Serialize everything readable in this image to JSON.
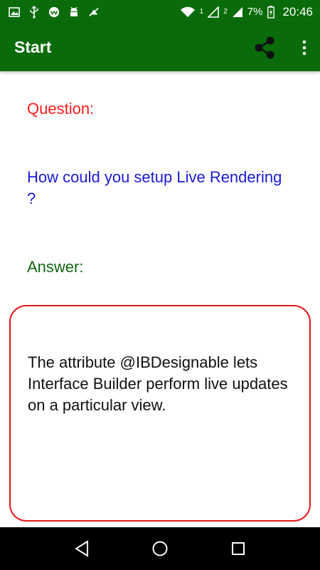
{
  "status_bar": {
    "battery_percent": "7%",
    "time": "20:46",
    "sim1_label": "1",
    "sim2_label": "2",
    "left_icons": [
      "image-icon",
      "usb-icon",
      "wear-icon",
      "android-icon",
      "crossed-bell-icon"
    ],
    "right_icons": [
      "wifi-icon",
      "signal-icon",
      "signal-icon",
      "battery-charging-icon"
    ]
  },
  "toolbar": {
    "title": "Start",
    "actions": [
      "share-icon",
      "overflow-menu-icon"
    ],
    "color": "#0a6b0a"
  },
  "main": {
    "question_label": "Question:",
    "question_text": "How could you setup Live Rendering ?",
    "answer_label": "Answer:",
    "answer_text": "The attribute @IBDesignable lets Interface Builder perform live updates on a particular view.",
    "colors": {
      "question_label": "#ff1a1a",
      "question_text": "#1a1ad8",
      "answer_label": "#126612",
      "answer_border": "#e31b1b"
    }
  },
  "nav_bar": {
    "buttons": [
      "back-icon",
      "home-icon",
      "recents-icon"
    ]
  }
}
